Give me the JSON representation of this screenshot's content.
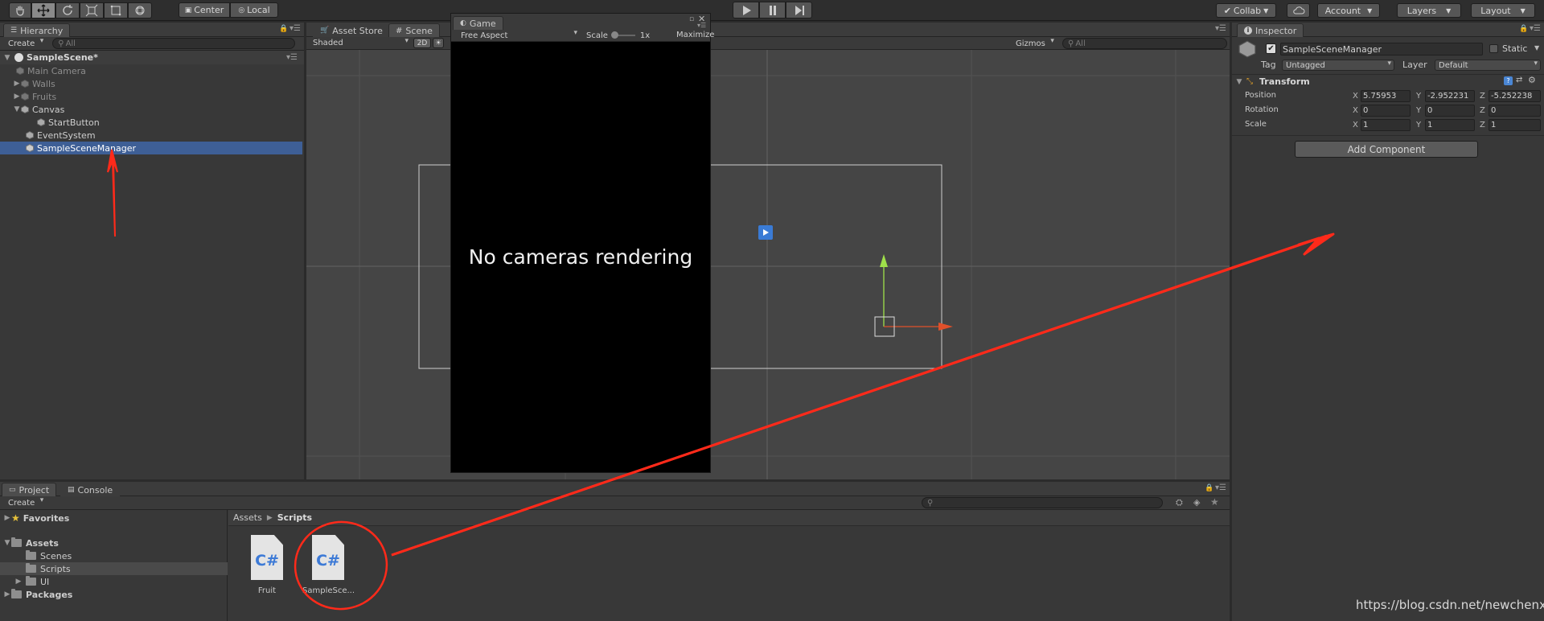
{
  "toolbar": {
    "pivot_center": "Center",
    "pivot_local": "Local",
    "collab": "Collab",
    "account": "Account",
    "layers": "Layers",
    "layout": "Layout"
  },
  "hierarchy": {
    "tab": "Hierarchy",
    "create": "Create",
    "search_placeholder": "All",
    "scene": "SampleScene*",
    "items": [
      {
        "label": "Main Camera"
      },
      {
        "label": "Walls"
      },
      {
        "label": "Fruits"
      },
      {
        "label": "Canvas"
      },
      {
        "label": "StartButton"
      },
      {
        "label": "EventSystem"
      },
      {
        "label": "SampleSceneManager"
      }
    ]
  },
  "scene_view": {
    "tab_asset_store": "Asset Store",
    "tab_scene": "Scene",
    "shading": "Shaded",
    "mode_2d": "2D",
    "gizmos": "Gizmos",
    "search_placeholder": "All"
  },
  "game_view": {
    "tab": "Game",
    "aspect": "Free Aspect",
    "scale_label": "Scale",
    "scale_value": "1x",
    "maximize": "Maximize",
    "message": "No cameras rendering"
  },
  "inspector": {
    "tab": "Inspector",
    "object_name": "SampleSceneManager",
    "static_label": "Static",
    "tag_label": "Tag",
    "tag_value": "Untagged",
    "layer_label": "Layer",
    "layer_value": "Default",
    "component": "Transform",
    "axes": [
      "X",
      "Y",
      "Z"
    ],
    "rows": [
      {
        "label": "Position",
        "x": "5.75953",
        "y": "-2.952231",
        "z": "-5.252238"
      },
      {
        "label": "Rotation",
        "x": "0",
        "y": "0",
        "z": "0"
      },
      {
        "label": "Scale",
        "x": "1",
        "y": "1",
        "z": "1"
      }
    ],
    "add_component": "Add Component"
  },
  "project": {
    "tab_project": "Project",
    "tab_console": "Console",
    "create": "Create",
    "favorites": "Favorites",
    "assets": "Assets",
    "folders": [
      "Scenes",
      "Scripts",
      "UI"
    ],
    "packages": "Packages",
    "breadcrumb_root": "Assets",
    "breadcrumb_current": "Scripts",
    "files": [
      {
        "name": "Fruit",
        "icon": "C#"
      },
      {
        "name": "SampleSce...",
        "icon": "C#"
      }
    ]
  },
  "watermark": "https://blog.csdn.net/newchenxf",
  "colors": {
    "selection": "#3e5f96",
    "annotation_red": "#ff2a1a"
  }
}
